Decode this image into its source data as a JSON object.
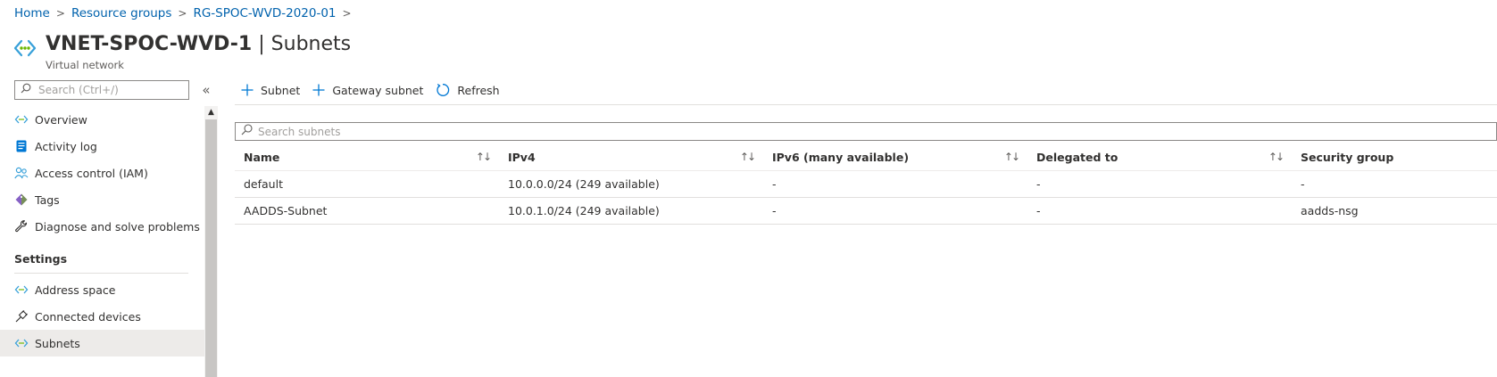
{
  "breadcrumb": [
    "Home",
    "Resource groups",
    "RG-SPOC-WVD-2020-01"
  ],
  "header": {
    "resource_name": "VNET-SPOC-WVD-1",
    "divider": "|",
    "blade": "Subnets",
    "subtitle": "Virtual network"
  },
  "sidebar": {
    "search_placeholder": "Search (Ctrl+/)",
    "collapse_glyph": "«",
    "items": [
      {
        "label": "Overview",
        "icon": "vnet-icon"
      },
      {
        "label": "Activity log",
        "icon": "activity-log-icon"
      },
      {
        "label": "Access control (IAM)",
        "icon": "iam-icon"
      },
      {
        "label": "Tags",
        "icon": "tag-icon"
      },
      {
        "label": "Diagnose and solve problems",
        "icon": "wrench-icon"
      }
    ],
    "section_settings": "Settings",
    "settings_items": [
      {
        "label": "Address space",
        "icon": "vnet-icon"
      },
      {
        "label": "Connected devices",
        "icon": "plug-icon"
      },
      {
        "label": "Subnets",
        "icon": "vnet-icon",
        "selected": true
      }
    ]
  },
  "toolbar": {
    "add_subnet": "Subnet",
    "add_gateway_subnet": "Gateway subnet",
    "refresh": "Refresh"
  },
  "filter": {
    "placeholder": "Search subnets"
  },
  "table": {
    "columns": [
      "Name",
      "IPv4",
      "IPv6 (many available)",
      "Delegated to",
      "Security group"
    ],
    "rows": [
      [
        "default",
        "10.0.0.0/24 (249 available)",
        "-",
        "-",
        "-"
      ],
      [
        "AADDS-Subnet",
        "10.0.1.0/24 (249 available)",
        "-",
        "-",
        "aadds-nsg"
      ]
    ]
  },
  "colors": {
    "link": "#0062ad",
    "accent": "#0078d4",
    "vnet": "#37a0d9",
    "tag": "#8661c5"
  }
}
